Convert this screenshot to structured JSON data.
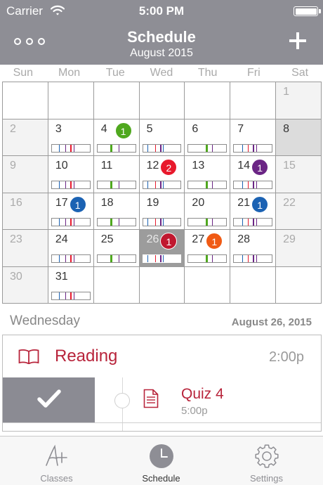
{
  "status_bar": {
    "carrier": "Carrier",
    "time": "5:00 PM"
  },
  "header": {
    "title": "Schedule",
    "subtitle": "August 2015"
  },
  "weekdays": [
    "Sun",
    "Mon",
    "Tue",
    "Wed",
    "Thu",
    "Fri",
    "Sat"
  ],
  "calendar": {
    "days": [
      "",
      "",
      "",
      "",
      "",
      "",
      "1",
      "2",
      "3",
      "4",
      "5",
      "6",
      "7",
      "8",
      "9",
      "10",
      "11",
      "12",
      "13",
      "14",
      "15",
      "16",
      "17",
      "18",
      "19",
      "20",
      "21",
      "22",
      "23",
      "24",
      "25",
      "26",
      "27",
      "28",
      "29",
      "30",
      "31",
      "",
      "",
      "",
      "",
      ""
    ],
    "badges": {
      "4": "1",
      "12": "2",
      "14": "1",
      "17": "1",
      "21": "1",
      "26": "1",
      "27": "1"
    },
    "selected_day": "26",
    "colors": {
      "green": "#4fa81e",
      "red": "#e8192c",
      "purple": "#6b2585",
      "blue": "#1b62b3",
      "orange": "#f05a14",
      "crimson": "#c0182f",
      "header_gray": "#8e8e95",
      "accent_red": "#b8243b"
    }
  },
  "day_header": {
    "weekday": "Wednesday",
    "date": "August 26, 2015"
  },
  "events": {
    "reading": {
      "title": "Reading",
      "time": "2:00p"
    },
    "quiz": {
      "title": "Quiz 4",
      "time": "5:00p"
    }
  },
  "icons": {
    "more": "more-dots-icon",
    "add": "plus-icon",
    "book": "book-icon",
    "check": "checkmark-icon",
    "document": "document-icon",
    "classes": "a-plus-icon",
    "schedule": "clock-icon",
    "settings": "gear-icon"
  },
  "tabs": [
    {
      "label": "Classes"
    },
    {
      "label": "Schedule"
    },
    {
      "label": "Settings"
    }
  ]
}
